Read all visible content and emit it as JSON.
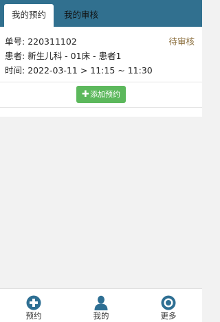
{
  "tabs": [
    {
      "label": "我的预约",
      "active": true
    },
    {
      "label": "我的审核",
      "active": false
    }
  ],
  "appointment": {
    "number_label": "单号:",
    "number_value": "220311102",
    "status": "待审核",
    "patient_label": "患者:",
    "patient_value": "新生儿科 - 01床 - 患者1",
    "time_label": "时间:",
    "time_value": "2022-03-11 > 11:15 ~ 11:30"
  },
  "add_button": {
    "icon": "plus-icon",
    "label": "添加预约"
  },
  "bottom_nav": [
    {
      "label": "预约",
      "icon": "plus-circle-icon"
    },
    {
      "label": "我的",
      "icon": "user-icon"
    },
    {
      "label": "更多",
      "icon": "more-circle-icon"
    }
  ],
  "colors": {
    "header": "#31708f",
    "status": "#8a6d3b",
    "add_button": "#5cb85c",
    "nav_icon": "#2e6f93",
    "background": "#f2f2f2"
  }
}
